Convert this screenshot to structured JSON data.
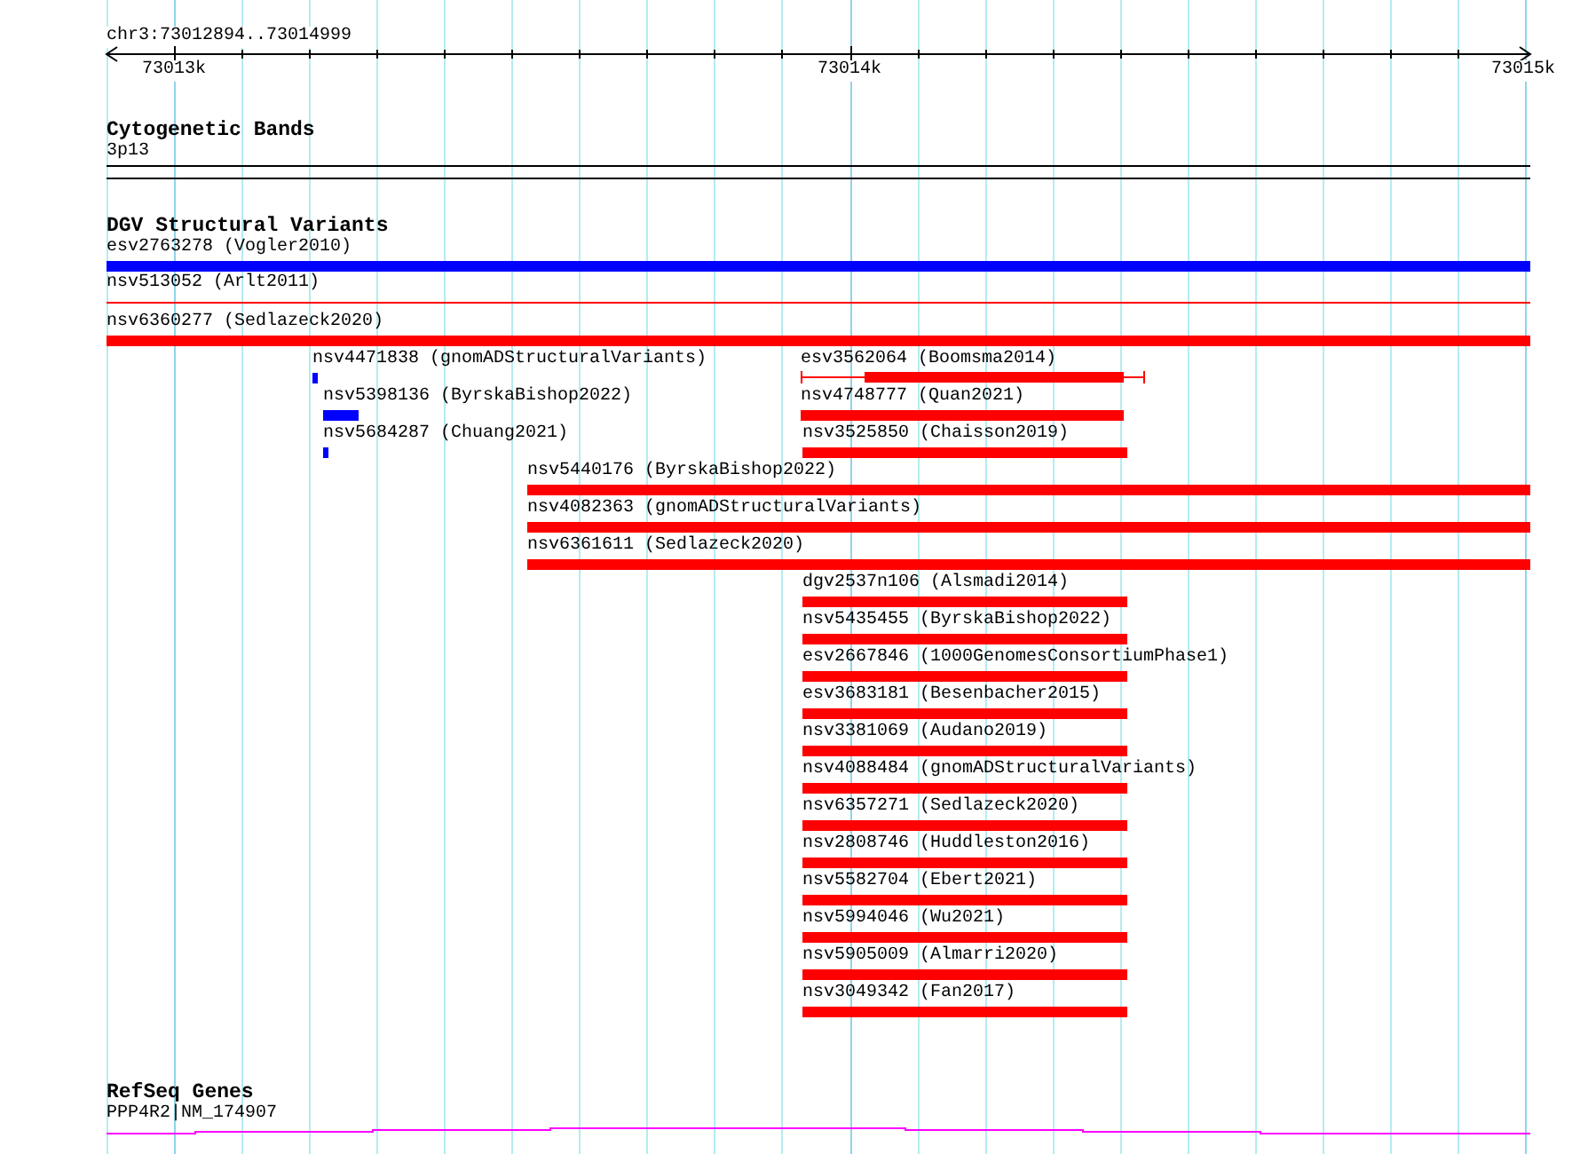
{
  "ruler": {
    "location": "chr3:73012894..73014999",
    "ticks": [
      "73013k",
      "73014k",
      "73015k"
    ]
  },
  "tracks": [
    {
      "title": "Cytogenetic Bands",
      "kind": "band",
      "features": [
        {
          "label": "3p13"
        }
      ]
    },
    {
      "title": "DGV Structural Variants",
      "kind": "variants",
      "features": [
        {
          "label": "esv2763278 (Vogler2010)",
          "kind": "bar",
          "color": "#0000ff"
        },
        {
          "label": "nsv513052 (Arlt2011)",
          "kind": "line",
          "color": "#ff0000"
        },
        {
          "label": "nsv6360277 (Sedlazeck2020)",
          "kind": "bar",
          "color": "#ff0000"
        },
        {
          "label": "nsv4471838 (gnomADStructuralVariants)",
          "kind": "bar",
          "color": "#0000ff"
        },
        {
          "label": "esv3562064 (Boomsma2014)",
          "kind": "whisker",
          "color": "#ff0000"
        },
        {
          "label": "nsv5398136 (ByrskaBishop2022)",
          "kind": "bar",
          "color": "#0000ff"
        },
        {
          "label": "nsv4748777 (Quan2021)",
          "kind": "bar",
          "color": "#ff0000"
        },
        {
          "label": "nsv5684287 (Chuang2021)",
          "kind": "bar",
          "color": "#0000ff"
        },
        {
          "label": "nsv3525850 (Chaisson2019)",
          "kind": "bar",
          "color": "#ff0000"
        },
        {
          "label": "nsv5440176 (ByrskaBishop2022)",
          "kind": "bar",
          "color": "#ff0000"
        },
        {
          "label": "nsv4082363 (gnomADStructuralVariants)",
          "kind": "bar",
          "color": "#ff0000"
        },
        {
          "label": "nsv6361611 (Sedlazeck2020)",
          "kind": "bar",
          "color": "#ff0000"
        },
        {
          "label": "dgv2537n106 (Alsmadi2014)",
          "kind": "bar",
          "color": "#ff0000"
        },
        {
          "label": "nsv5435455 (ByrskaBishop2022)",
          "kind": "bar",
          "color": "#ff0000"
        },
        {
          "label": "esv2667846 (1000GenomesConsortiumPhase1)",
          "kind": "bar",
          "color": "#ff0000"
        },
        {
          "label": "esv3683181 (Besenbacher2015)",
          "kind": "bar",
          "color": "#ff0000"
        },
        {
          "label": "nsv3381069 (Audano2019)",
          "kind": "bar",
          "color": "#ff0000"
        },
        {
          "label": "nsv4088484 (gnomADStructuralVariants)",
          "kind": "bar",
          "color": "#ff0000"
        },
        {
          "label": "nsv6357271 (Sedlazeck2020)",
          "kind": "bar",
          "color": "#ff0000"
        },
        {
          "label": "nsv2808746 (Huddleston2016)",
          "kind": "bar",
          "color": "#ff0000"
        },
        {
          "label": "nsv5582704 (Ebert2021)",
          "kind": "bar",
          "color": "#ff0000"
        },
        {
          "label": "nsv5994046 (Wu2021)",
          "kind": "bar",
          "color": "#ff0000"
        },
        {
          "label": "nsv5905009 (Almarri2020)",
          "kind": "bar",
          "color": "#ff0000"
        },
        {
          "label": "nsv3049342 (Fan2017)",
          "kind": "bar",
          "color": "#ff0000"
        }
      ]
    },
    {
      "title": "RefSeq Genes",
      "kind": "gene",
      "features": [
        {
          "label": "PPP4R2|NM_174907"
        }
      ]
    }
  ]
}
